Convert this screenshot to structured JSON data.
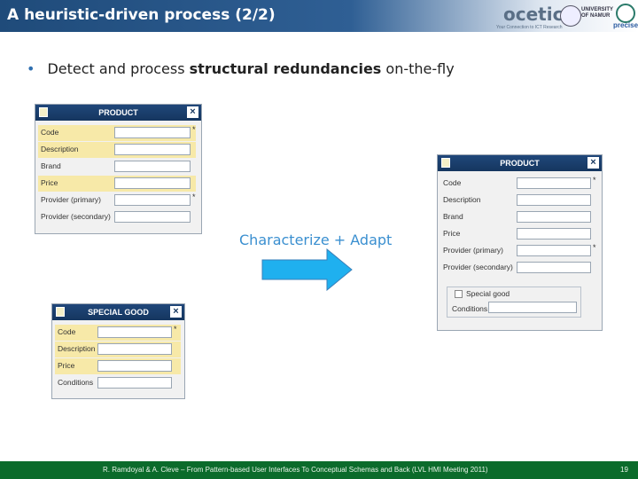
{
  "slide": {
    "title": "A heuristic-driven process (2/2)",
    "bullet_pre": "Detect and process ",
    "bullet_bold": "structural redundancies",
    "bullet_post": " on-the-fly",
    "center_label": "Characterize + Adapt",
    "footer": "R. Ramdoyal & A. Cleve – From Pattern-based User Interfaces To Conceptual Schemas and Back (LVL HMI Meeting 2011)",
    "page_number": "19"
  },
  "logos": {
    "ocetic": "ocetic",
    "ocetic_tag": "Your Connection to ICT Research",
    "university": "UNIVERSITY OF NAMUR",
    "precise": "precise"
  },
  "product_window": {
    "title": "PRODUCT",
    "close_label": "×",
    "fields": [
      {
        "label": "Code",
        "required": "*"
      },
      {
        "label": "Description"
      },
      {
        "label": "Brand"
      },
      {
        "label": "Price"
      },
      {
        "label": "Provider (primary)",
        "required": "*"
      },
      {
        "label": "Provider (secondary)"
      }
    ]
  },
  "special_window": {
    "title": "SPECIAL GOOD",
    "close_label": "×",
    "fields": [
      {
        "label": "Code",
        "required": "*"
      },
      {
        "label": "Description"
      },
      {
        "label": "Price"
      },
      {
        "label": "Conditions"
      }
    ]
  },
  "adapted_window": {
    "title": "PRODUCT",
    "close_label": "×",
    "fields": [
      {
        "label": "Code",
        "required": "*"
      },
      {
        "label": "Description"
      },
      {
        "label": "Brand"
      },
      {
        "label": "Price"
      },
      {
        "label": "Provider (primary)",
        "required": "*"
      },
      {
        "label": "Provider (secondary)"
      }
    ],
    "group_checkbox_label": "Special good",
    "group_field_label": "Conditions"
  },
  "colors": {
    "accent": "#3a8fd0",
    "highlight": "#f7e9a8",
    "window_title": "#20477a",
    "footer": "#0b6b2b"
  }
}
